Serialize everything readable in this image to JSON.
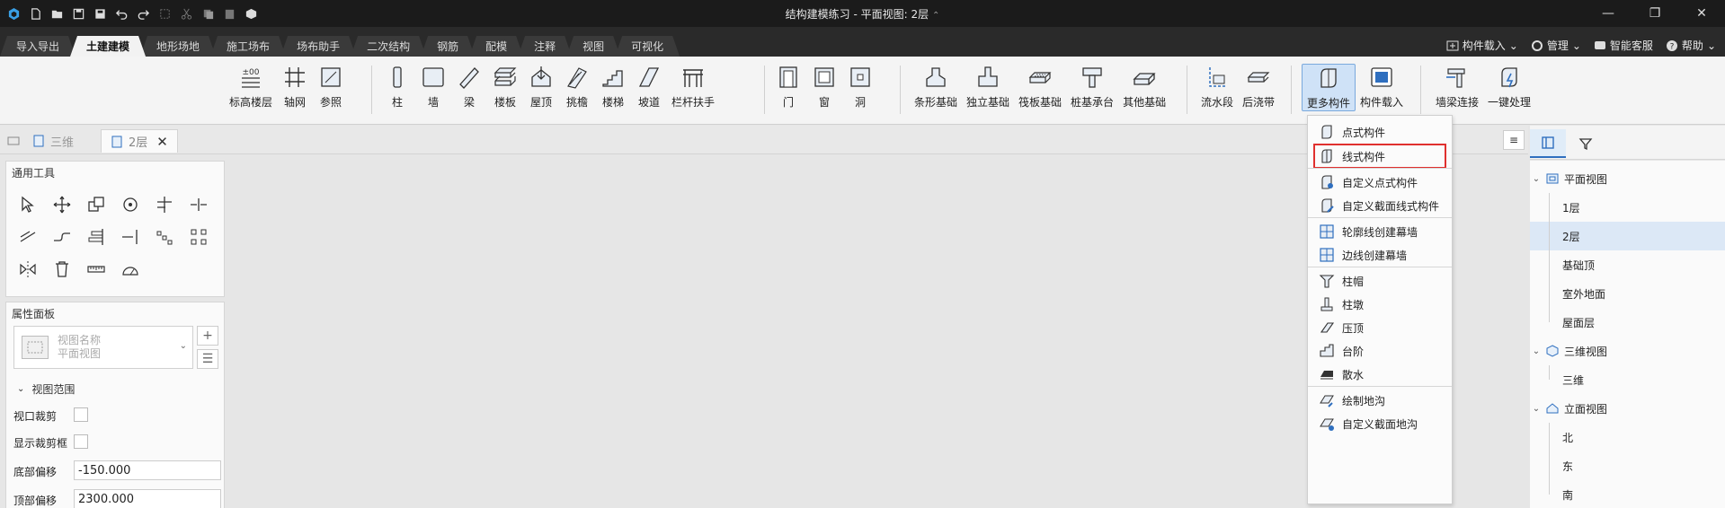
{
  "window": {
    "title": "结构建模练习 - 平面视图: 2层",
    "title_chevron": "⌃"
  },
  "tabs": [
    "导入导出",
    "土建建模",
    "地形场地",
    "施工场布",
    "场布助手",
    "二次结构",
    "钢筋",
    "配模",
    "注释",
    "视图",
    "可视化"
  ],
  "active_tab": "土建建模",
  "tab_right": {
    "load_component": "构件载入",
    "manage": "管理",
    "service": "智能客服",
    "help": "帮助"
  },
  "ribbon": {
    "group1": [
      "标高楼层",
      "轴网",
      "参照"
    ],
    "group2": [
      "柱",
      "墙",
      "梁",
      "楼板",
      "屋顶",
      "挑檐",
      "楼梯",
      "坡道",
      "栏杆扶手"
    ],
    "group3": [
      "门",
      "窗",
      "洞"
    ],
    "group4": [
      "条形基础",
      "独立基础",
      "筏板基础",
      "桩基承台",
      "其他基础"
    ],
    "group5": [
      "流水段",
      "后浇带"
    ],
    "group6": [
      "更多构件",
      "构件载入"
    ],
    "group7": [
      "墙梁连接",
      "一键处理"
    ]
  },
  "doc_tabs": [
    "三维",
    "2层"
  ],
  "tools_panel": {
    "title": "通用工具"
  },
  "prop_panel": {
    "title": "属性面板",
    "view_name_label": "视图名称",
    "view_name_value": "平面视图",
    "section": "视图范围",
    "rows": [
      {
        "label": "视口裁剪"
      },
      {
        "label": "显示裁剪框"
      },
      {
        "label": "底部偏移",
        "value": "-150.000"
      },
      {
        "label": "顶部偏移",
        "value": "2300.000"
      }
    ]
  },
  "more_menu": {
    "items": [
      "点式构件",
      "线式构件",
      "自定义点式构件",
      "自定义截面线式构件",
      "轮廓线创建幕墙",
      "边线创建幕墙",
      "柱帽",
      "柱墩",
      "压顶",
      "台阶",
      "散水",
      "绘制地沟",
      "自定义截面地沟"
    ],
    "highlighted": "线式构件"
  },
  "tree": {
    "plan": "平面视图",
    "plan_items": [
      "1层",
      "2层",
      "基础顶",
      "室外地面",
      "屋面层"
    ],
    "view3d": "三维视图",
    "view3d_items": [
      "三维"
    ],
    "elev": "立面视图",
    "elev_items": [
      "北",
      "东",
      "南"
    ],
    "selected": "2层"
  },
  "colors": {
    "accent": "#2f6fbf",
    "highlight_border": "#e0302e",
    "titlebar": "#1b1b1b"
  }
}
